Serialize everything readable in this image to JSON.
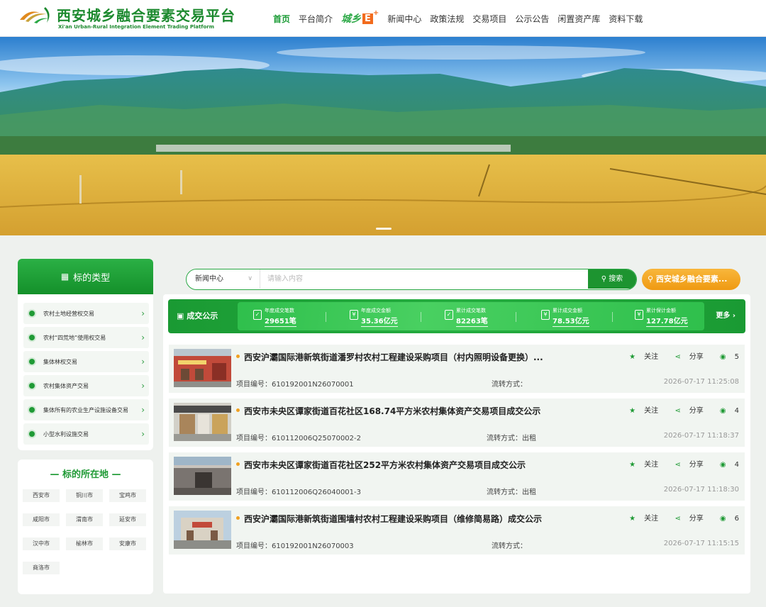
{
  "header": {
    "site_title": "西安城乡融合要素交易平台",
    "site_subtitle": "Xi'an Urban-Rural Integration Element Trading Platform",
    "nav": [
      {
        "label": "首页",
        "active": true
      },
      {
        "label": "平台简介"
      },
      {
        "label": "城乡E+",
        "special": true
      },
      {
        "label": "新闻中心"
      },
      {
        "label": "政策法规"
      },
      {
        "label": "交易项目"
      },
      {
        "label": "公示公告"
      },
      {
        "label": "闲置资产库"
      },
      {
        "label": "资料下载"
      }
    ],
    "nav_e": {
      "text": "城乡",
      "box": "E",
      "plus": "+"
    }
  },
  "sidebar": {
    "type_title": "标的类型",
    "types": [
      "农村土地经营权交易",
      "农村“四荒地”使用权交易",
      "集体林权交易",
      "农村集体资产交易",
      "集体所有的农业生产设施设备交易",
      "小型水利设施交易"
    ],
    "location_title": "— 标的所在地 —",
    "locations": [
      "西安市",
      "铜川市",
      "宝鸡市",
      "咸阳市",
      "渭南市",
      "延安市",
      "汉中市",
      "榆林市",
      "安康市",
      "商洛市"
    ]
  },
  "search": {
    "category": "新闻中心",
    "placeholder": "请输入内容",
    "button": "搜索",
    "region_button": "西安城乡融合要素..."
  },
  "stats": {
    "label": "成交公示",
    "more": "更多",
    "items": [
      {
        "label": "年度成交笔数",
        "value": "29651笔"
      },
      {
        "label": "年度成交金额",
        "value": "35.36亿元"
      },
      {
        "label": "累计成交笔数",
        "value": "82263笔"
      },
      {
        "label": "累计成交金额",
        "value": "78.53亿元"
      },
      {
        "label": "累计保计金额",
        "value": "127.78亿元"
      }
    ]
  },
  "projects": [
    {
      "title": "西安沪灞国际港新筑街道潘罗村农村工程建设采购项目（村内照明设备更换）...",
      "code_label": "项目编号：",
      "code": "610192001N26070001",
      "mode_label": "流转方式：",
      "mode": "",
      "time": "2026-07-17 11:25:08",
      "follow": "关注",
      "share": "分享",
      "views": "5"
    },
    {
      "title": "西安市未央区谭家街道百花社区168.74平方米农村集体资产交易项目成交公示",
      "code_label": "项目编号：",
      "code": "610112006Q25070002-2",
      "mode_label": "流转方式：",
      "mode": "出租",
      "time": "2026-07-17 11:18:37",
      "follow": "关注",
      "share": "分享",
      "views": "4"
    },
    {
      "title": "西安市未央区谭家街道百花社区252平方米农村集体资产交易项目成交公示",
      "code_label": "项目编号：",
      "code": "610112006Q26040001-3",
      "mode_label": "流转方式：",
      "mode": "出租",
      "time": "2026-07-17 11:18:30",
      "follow": "关注",
      "share": "分享",
      "views": "4"
    },
    {
      "title": "西安沪灞国际港新筑街道围墙村农村工程建设采购项目（维修简易路）成交公示",
      "code_label": "项目编号：",
      "code": "610192001N26070003",
      "mode_label": "流转方式：",
      "mode": "",
      "time": "2026-07-17 11:15:15",
      "follow": "关注",
      "share": "分享",
      "views": "6"
    }
  ]
}
